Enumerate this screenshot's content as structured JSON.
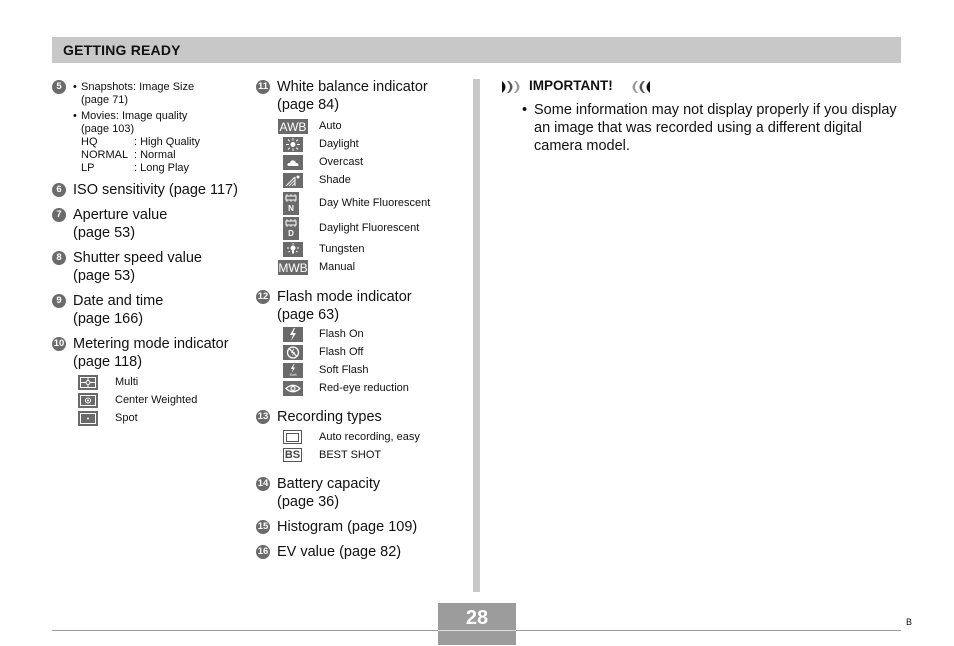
{
  "header": {
    "title": "GETTING READY"
  },
  "left_column": {
    "item5": {
      "number": "5",
      "bullets": [
        {
          "text": "Snapshots: Image Size",
          "sub": "(page 71)"
        },
        {
          "text": "Movies: Image quality",
          "sub": "(page 103)"
        }
      ],
      "quality_table": [
        {
          "code": "HQ",
          "meaning": ": High Quality"
        },
        {
          "code": "NORMAL",
          "meaning": ": Normal"
        },
        {
          "code": "LP",
          "meaning": ": Long Play"
        }
      ]
    },
    "items": [
      {
        "number": "6",
        "line1": "ISO sensitivity (page 117)",
        "line2": ""
      },
      {
        "number": "7",
        "line1": "Aperture value",
        "line2": "(page 53)"
      },
      {
        "number": "8",
        "line1": "Shutter speed value",
        "line2": "(page 53)"
      },
      {
        "number": "9",
        "line1": "Date and time",
        "line2": "(page 166)"
      },
      {
        "number": "10",
        "line1": "Metering mode indicator",
        "line2": "(page 118)"
      }
    ],
    "metering_modes": [
      {
        "icon": "multi-metering-icon",
        "label": "Multi"
      },
      {
        "icon": "center-weighted-metering-icon",
        "label": "Center Weighted"
      },
      {
        "icon": "spot-metering-icon",
        "label": "Spot"
      }
    ]
  },
  "middle_column": {
    "white_balance": {
      "number": "11",
      "line1": "White balance indicator",
      "line2": "(page 84)",
      "modes": [
        {
          "icon": "awb-icon",
          "icon_text": "AWB",
          "label": "Auto"
        },
        {
          "icon": "daylight-icon",
          "icon_text": "",
          "label": "Daylight"
        },
        {
          "icon": "overcast-icon",
          "icon_text": "",
          "label": "Overcast"
        },
        {
          "icon": "shade-icon",
          "icon_text": "",
          "label": "Shade"
        },
        {
          "icon": "day-white-fluorescent-icon",
          "icon_text": "N",
          "label": "Day White Fluorescent"
        },
        {
          "icon": "daylight-fluorescent-icon",
          "icon_text": "D",
          "label": "Daylight Fluorescent"
        },
        {
          "icon": "tungsten-icon",
          "icon_text": "",
          "label": "Tungsten"
        },
        {
          "icon": "mwb-icon",
          "icon_text": "MWB",
          "label": "Manual"
        }
      ]
    },
    "flash": {
      "number": "12",
      "line1": "Flash mode indicator",
      "line2": "(page 63)",
      "modes": [
        {
          "icon": "flash-on-icon",
          "label": "Flash On"
        },
        {
          "icon": "flash-off-icon",
          "label": "Flash Off"
        },
        {
          "icon": "soft-flash-icon",
          "icon_text": "Soft",
          "label": "Soft Flash"
        },
        {
          "icon": "red-eye-icon",
          "label": "Red-eye reduction"
        }
      ]
    },
    "recording": {
      "number": "13",
      "line1": "Recording types",
      "modes": [
        {
          "icon": "auto-recording-icon",
          "label": "Auto recording, easy"
        },
        {
          "icon": "best-shot-icon",
          "icon_text": "BS",
          "label": "BEST SHOT"
        }
      ]
    },
    "items": [
      {
        "number": "14",
        "line1": "Battery capacity",
        "line2": "(page 36)"
      },
      {
        "number": "15",
        "line1": "Histogram (page 109)",
        "line2": ""
      },
      {
        "number": "16",
        "line1": "EV value (page 82)",
        "line2": ""
      }
    ]
  },
  "important": {
    "title": "IMPORTANT!",
    "bullet": "•",
    "text": "Some information may not display properly if you display an image that was recorded using a different digital camera model."
  },
  "footer": {
    "page_number": "28",
    "corner_letter": "B"
  }
}
